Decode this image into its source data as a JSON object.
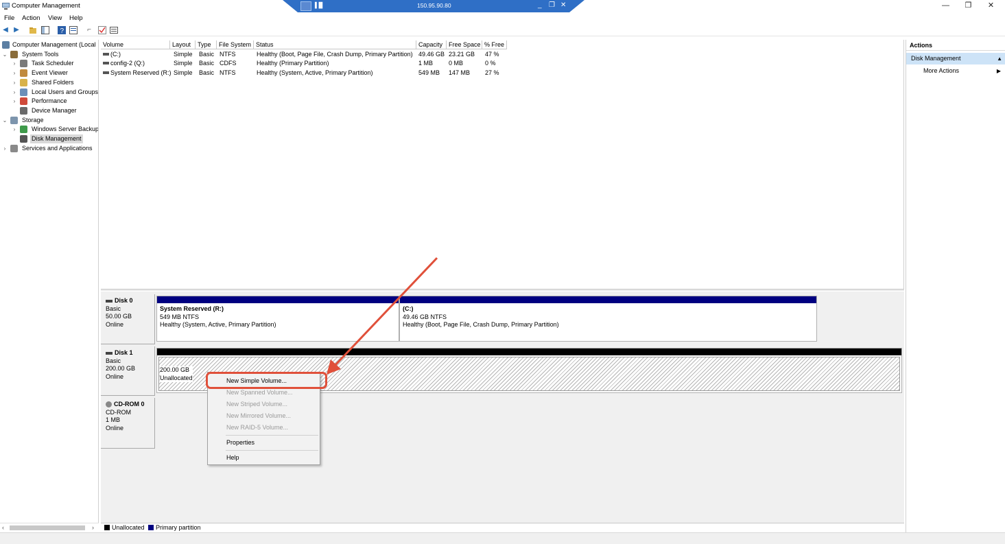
{
  "window": {
    "title": "Computer Management",
    "minimize": "—",
    "maximize": "❐",
    "close": "✕"
  },
  "remote": {
    "ip": "150.95.90.80",
    "signal": "▐▐▌",
    "minimize": "_",
    "restore": "❐",
    "close": "✕"
  },
  "menu": [
    "File",
    "Action",
    "View",
    "Help"
  ],
  "toolbar": {
    "icons": [
      "back-icon",
      "forward-icon",
      "up-folder-icon",
      "show-hide-console-tree-icon",
      "help-icon",
      "properties-icon",
      "connect-icon",
      "checkmark-icon",
      "list-view-icon"
    ]
  },
  "tree": {
    "items": [
      {
        "label": "Computer Management (Local",
        "expander": "",
        "indent": 0,
        "icon": "computer-management-icon",
        "color": "#5c7fa3"
      },
      {
        "label": "System Tools",
        "expander": "⌄",
        "indent": 1,
        "icon": "system-tools-icon",
        "color": "#8a6d3b"
      },
      {
        "label": "Task Scheduler",
        "expander": "›",
        "indent": 2,
        "icon": "clock-icon",
        "color": "#7a7a7a"
      },
      {
        "label": "Event Viewer",
        "expander": "›",
        "indent": 2,
        "icon": "event-viewer-icon",
        "color": "#c08a3e"
      },
      {
        "label": "Shared Folders",
        "expander": "›",
        "indent": 2,
        "icon": "shared-folders-icon",
        "color": "#d8b24a"
      },
      {
        "label": "Local Users and Groups",
        "expander": "›",
        "indent": 2,
        "icon": "users-icon",
        "color": "#6b8fb8"
      },
      {
        "label": "Performance",
        "expander": "›",
        "indent": 2,
        "icon": "performance-icon",
        "color": "#d04a3a"
      },
      {
        "label": "Device Manager",
        "expander": "",
        "indent": 2,
        "icon": "device-manager-icon",
        "color": "#6a6a6a"
      },
      {
        "label": "Storage",
        "expander": "⌄",
        "indent": 1,
        "icon": "storage-icon",
        "color": "#7d95ad"
      },
      {
        "label": "Windows Server Backup",
        "expander": "›",
        "indent": 2,
        "icon": "backup-icon",
        "color": "#3f9a4a"
      },
      {
        "label": "Disk Management",
        "expander": "",
        "indent": 2,
        "icon": "disk-management-icon",
        "color": "#555555",
        "selected": true
      },
      {
        "label": "Services and Applications",
        "expander": "›",
        "indent": 1,
        "icon": "services-icon",
        "color": "#8a8a8a"
      }
    ],
    "scroll_left": "‹",
    "scroll_right": "›"
  },
  "volumes": {
    "columns": [
      "Volume",
      "Layout",
      "Type",
      "File System",
      "Status",
      "Capacity",
      "Free Space",
      "% Free"
    ],
    "rows": [
      {
        "volume": "(C:)",
        "layout": "Simple",
        "type": "Basic",
        "fs": "NTFS",
        "status": "Healthy (Boot, Page File, Crash Dump, Primary Partition)",
        "capacity": "49.46 GB",
        "free": "23.21 GB",
        "pct": "47 %"
      },
      {
        "volume": "config-2 (Q:)",
        "layout": "Simple",
        "type": "Basic",
        "fs": "CDFS",
        "status": "Healthy (Primary Partition)",
        "capacity": "1 MB",
        "free": "0 MB",
        "pct": "0 %"
      },
      {
        "volume": "System Reserved (R:)",
        "layout": "Simple",
        "type": "Basic",
        "fs": "NTFS",
        "status": "Healthy (System, Active, Primary Partition)",
        "capacity": "549 MB",
        "free": "147 MB",
        "pct": "27 %"
      }
    ]
  },
  "disks": [
    {
      "name": "Disk 0",
      "kind": "Basic",
      "size": "50.00 GB",
      "state": "Online",
      "partitions": [
        {
          "title": "System Reserved  (R:)",
          "line1": "549 MB NTFS",
          "line2": "Healthy (System, Active, Primary Partition)"
        },
        {
          "title": "(C:)",
          "line1": "49.46 GB NTFS",
          "line2": "Healthy (Boot, Page File, Crash Dump, Primary Partition)"
        }
      ]
    },
    {
      "name": "Disk 1",
      "kind": "Basic",
      "size": "200.00 GB",
      "state": "Online",
      "partitions": [
        {
          "title": "",
          "line1": "200.00 GB",
          "line2": "Unallocated"
        }
      ]
    },
    {
      "name": "CD-ROM 0",
      "kind": "CD-ROM",
      "size": "1 MB",
      "state": "Online",
      "partitions": []
    }
  ],
  "legend": [
    {
      "label": "Unallocated",
      "color": "#000000"
    },
    {
      "label": "Primary partition",
      "color": "#000080"
    }
  ],
  "actions": {
    "header": "Actions",
    "section": "Disk Management",
    "section_arrow": "▲",
    "item": "More Actions",
    "item_arrow": "▶"
  },
  "context_menu": {
    "items": [
      {
        "label": "New Simple Volume...",
        "enabled": true
      },
      {
        "label": "New Spanned Volume...",
        "enabled": false
      },
      {
        "label": "New Striped Volume...",
        "enabled": false
      },
      {
        "label": "New Mirrored Volume...",
        "enabled": false
      },
      {
        "label": "New RAID-5 Volume...",
        "enabled": false
      },
      {
        "label": "Properties",
        "enabled": true
      },
      {
        "label": "Help",
        "enabled": true
      }
    ]
  },
  "colors": {
    "primary_partition": "#000080",
    "unallocated": "#000000",
    "annotation": "#e0503a",
    "remote_bar": "#2f6fc6",
    "selection": "#cde3f7"
  }
}
